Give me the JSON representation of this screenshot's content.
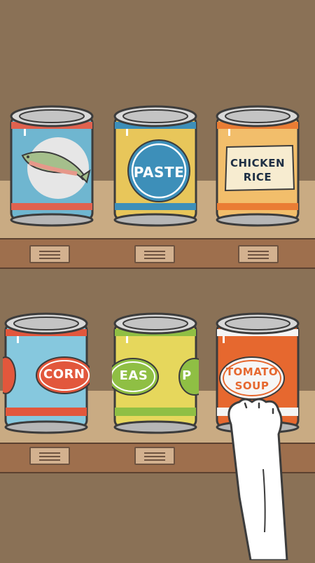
{
  "colors": {
    "wall": "#8a7156",
    "shelf": "#c9ab83",
    "shelf_lip": "#9e6f4d",
    "outline": "#3c3c3c"
  },
  "shelves": [
    {
      "cans": [
        {
          "id": "fish",
          "label": "",
          "icon": "salmon-icon",
          "body": "#6fb6d0",
          "band": "#e0624f",
          "oval": "#e6e6e6"
        },
        {
          "id": "paste",
          "label": "PASTE",
          "body": "#e8c65a",
          "band": "#3d8fb9",
          "oval": "#3d8fb9"
        },
        {
          "id": "chicken",
          "label_line1": "CHICKEN",
          "label_line2": "RICE",
          "body": "#f2be6b",
          "band": "#ea7d34",
          "oval": "#f7ecd0"
        }
      ]
    },
    {
      "cans": [
        {
          "id": "corn",
          "label": "CORN",
          "body": "#86c8de",
          "band": "#e2573c",
          "oval": "#e2573c"
        },
        {
          "id": "peas",
          "label": "EAS",
          "label_side": "P",
          "body": "#e6d75c",
          "band": "#8fbf44",
          "oval": "#8fbf44"
        },
        {
          "id": "tomato",
          "label_line1": "TOMATO",
          "label_line2": "SOUP",
          "body": "#e6682f",
          "band": "#f4f4f4",
          "oval": "#f6f6f6"
        }
      ]
    }
  ]
}
